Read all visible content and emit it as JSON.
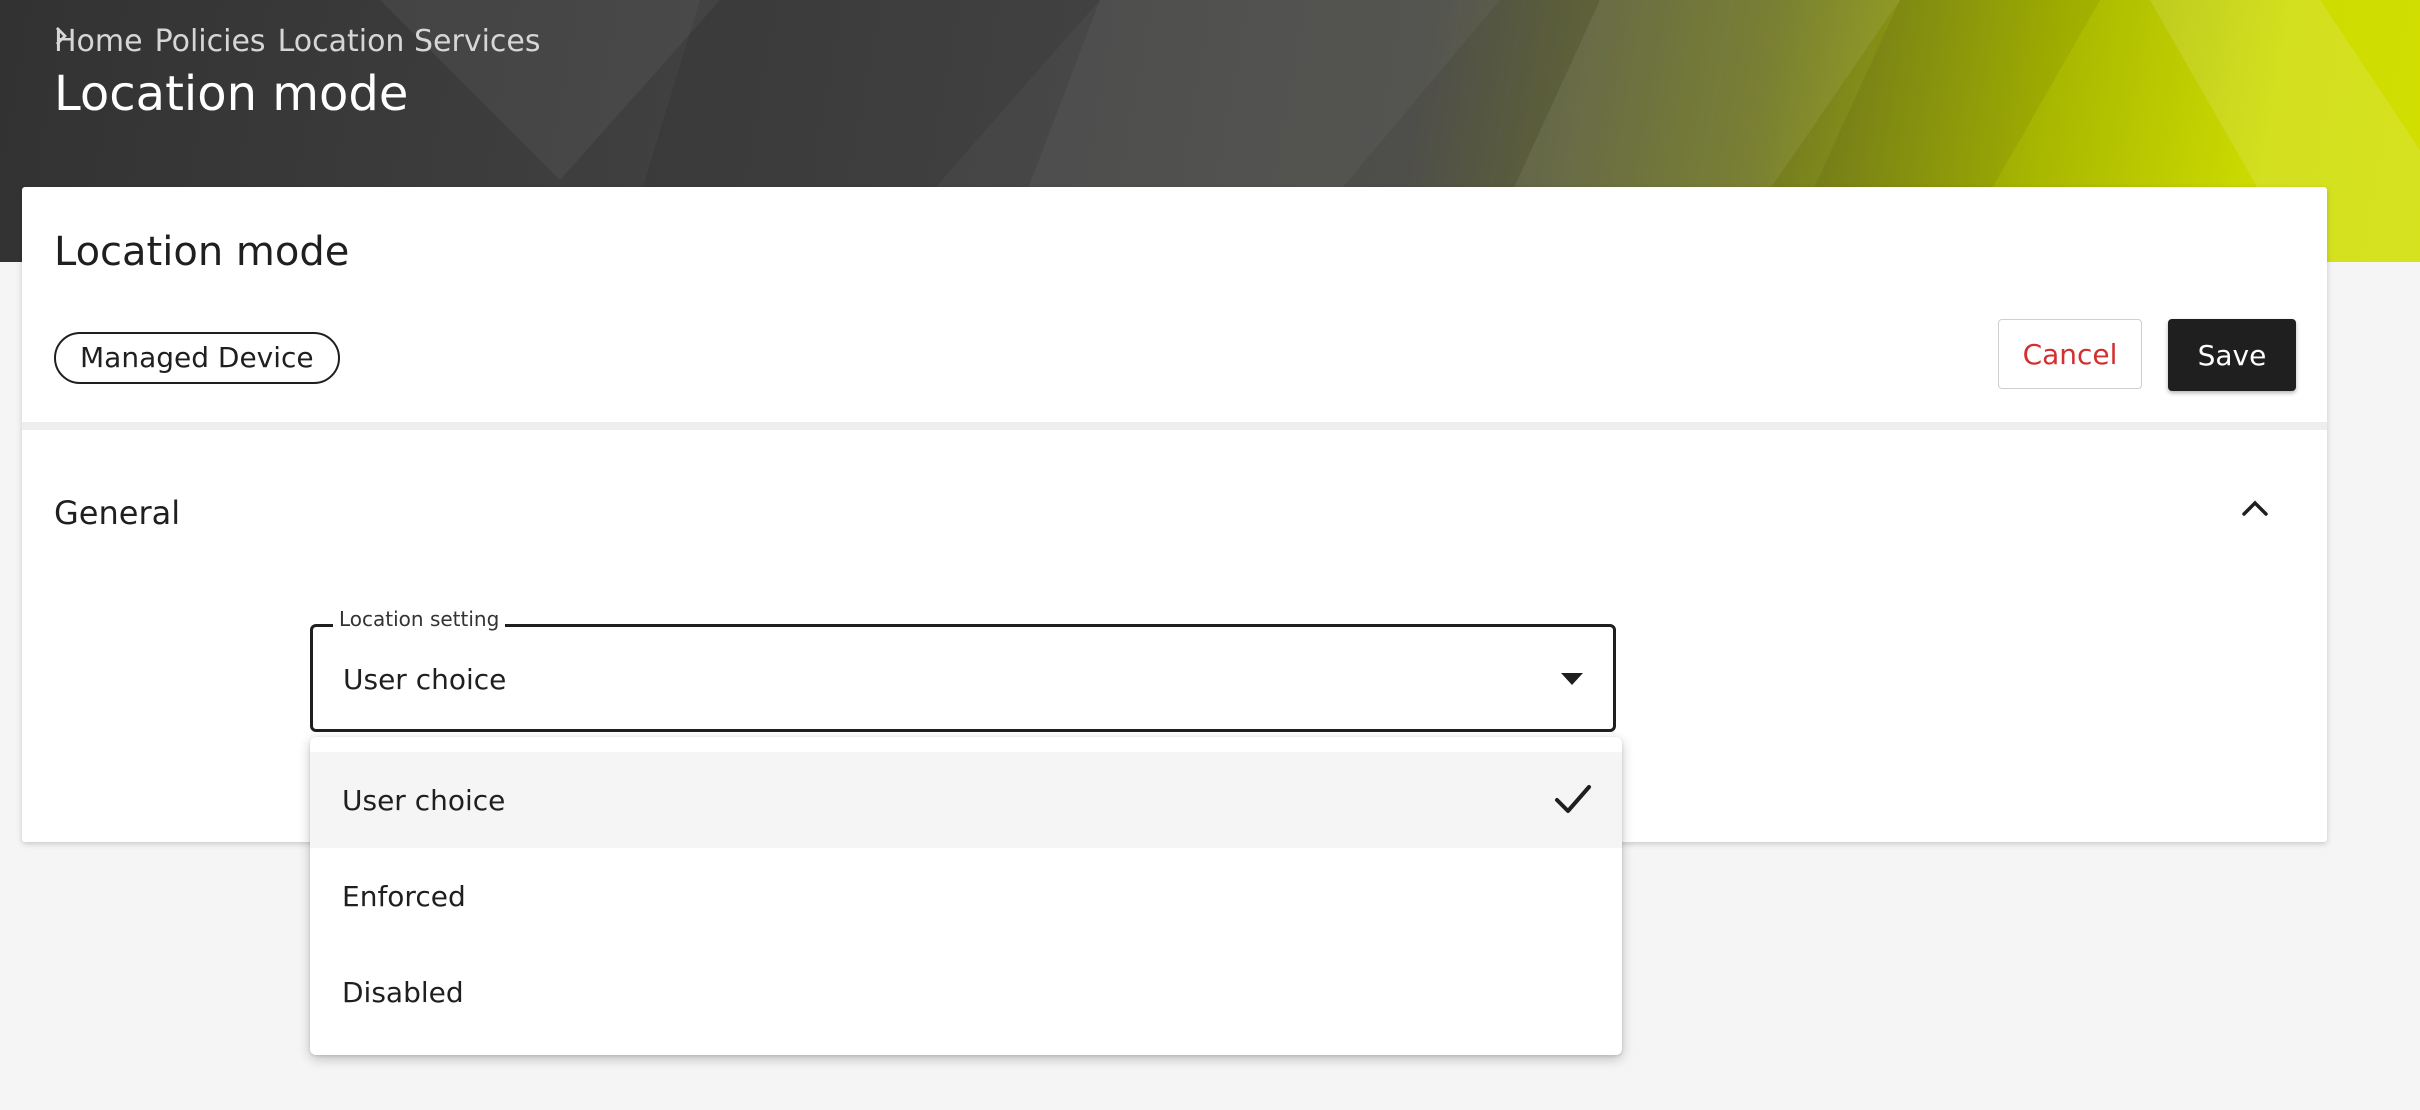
{
  "breadcrumb": {
    "items": [
      "Home",
      "Policies",
      "Location Services"
    ]
  },
  "header": {
    "title": "Location mode"
  },
  "card": {
    "title": "Location mode",
    "chip": "Managed Device",
    "cancel_label": "Cancel",
    "save_label": "Save"
  },
  "section": {
    "title": "General",
    "icon": "chevron-up-icon"
  },
  "location_setting": {
    "label": "Location setting",
    "value": "User choice",
    "options": [
      "User choice",
      "Enforced",
      "Disabled"
    ],
    "selected_index": 0
  },
  "colors": {
    "accent": "#cddc00",
    "danger": "#d32f2f",
    "primary": "#1f1f1f"
  }
}
